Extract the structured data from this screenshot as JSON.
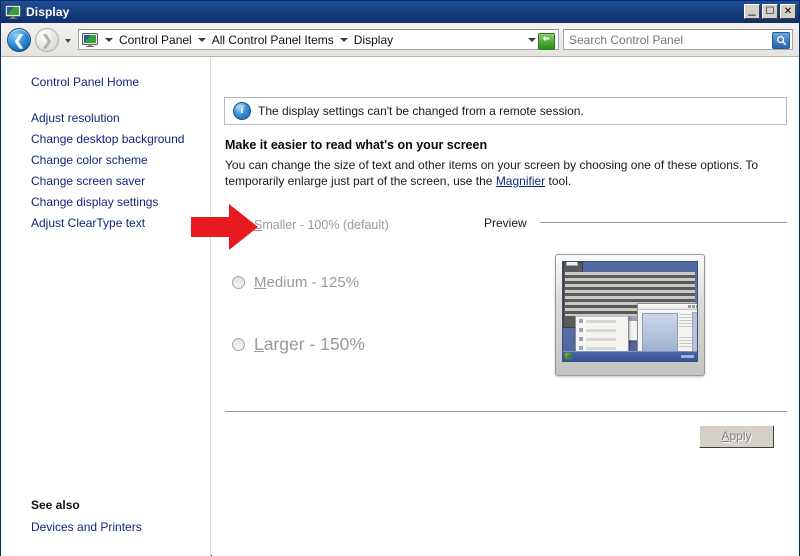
{
  "window": {
    "title": "Display",
    "icon": "display-monitor-icon",
    "controls": {
      "minimize": "–",
      "maximize": "❑",
      "close": "✕"
    }
  },
  "toolbar": {
    "back_label": "◀",
    "forward_label": "▶",
    "history_dropdown": "recent-locations-dropdown",
    "breadcrumbs": [
      "Control Panel",
      "All Control Panel Items",
      "Display"
    ],
    "refresh_label": "↻",
    "search": {
      "value": "",
      "placeholder": "Search Control Panel",
      "button_label": "🔍"
    },
    "help_label": "?"
  },
  "sidebar": {
    "home_label": "Control Panel Home",
    "items": [
      {
        "label": "Adjust resolution"
      },
      {
        "label": "Change desktop background"
      },
      {
        "label": "Change color scheme"
      },
      {
        "label": "Change screen saver"
      },
      {
        "label": "Change display settings"
      },
      {
        "label": "Adjust ClearType text"
      }
    ],
    "see_also_heading": "See also",
    "see_also_items": [
      {
        "label": "Devices and Printers"
      }
    ]
  },
  "main": {
    "info_bar": {
      "icon": "info-icon",
      "message": "The display settings can't be changed from a remote session."
    },
    "heading": "Make it easier to read what's on your screen",
    "description_before_link": "You can change the size of text and other items on your screen by choosing one of these options. To temporarily enlarge just part of the screen, use the ",
    "description_link": "Magnifier",
    "description_after_link": " tool.",
    "scale_options": [
      {
        "access_key": "S",
        "rest": "maller - 100% (default)",
        "selected": true,
        "disabled": true,
        "size": "small"
      },
      {
        "access_key": "M",
        "rest": "edium - 125%",
        "selected": false,
        "disabled": true,
        "size": "medium"
      },
      {
        "access_key": "L",
        "rest": "arger - 150%",
        "selected": false,
        "disabled": true,
        "size": "large"
      }
    ],
    "preview": {
      "label": "Preview",
      "graphic": "desktop-monitor-preview"
    },
    "apply": {
      "access_key": "A",
      "rest": "pply",
      "disabled": true
    }
  },
  "annotation": {
    "arrow": {
      "name": "red-pointer-arrow",
      "color": "#e8191f",
      "points_to": "scale-option-smaller"
    }
  },
  "colors": {
    "titlebar_start": "#1d4f9e",
    "titlebar_end": "#0d2f6b",
    "link": "#10267c",
    "disabled_text": "#9a9a9a",
    "annotation_red": "#e8191f",
    "desktop_blue": "#5d74ad"
  }
}
